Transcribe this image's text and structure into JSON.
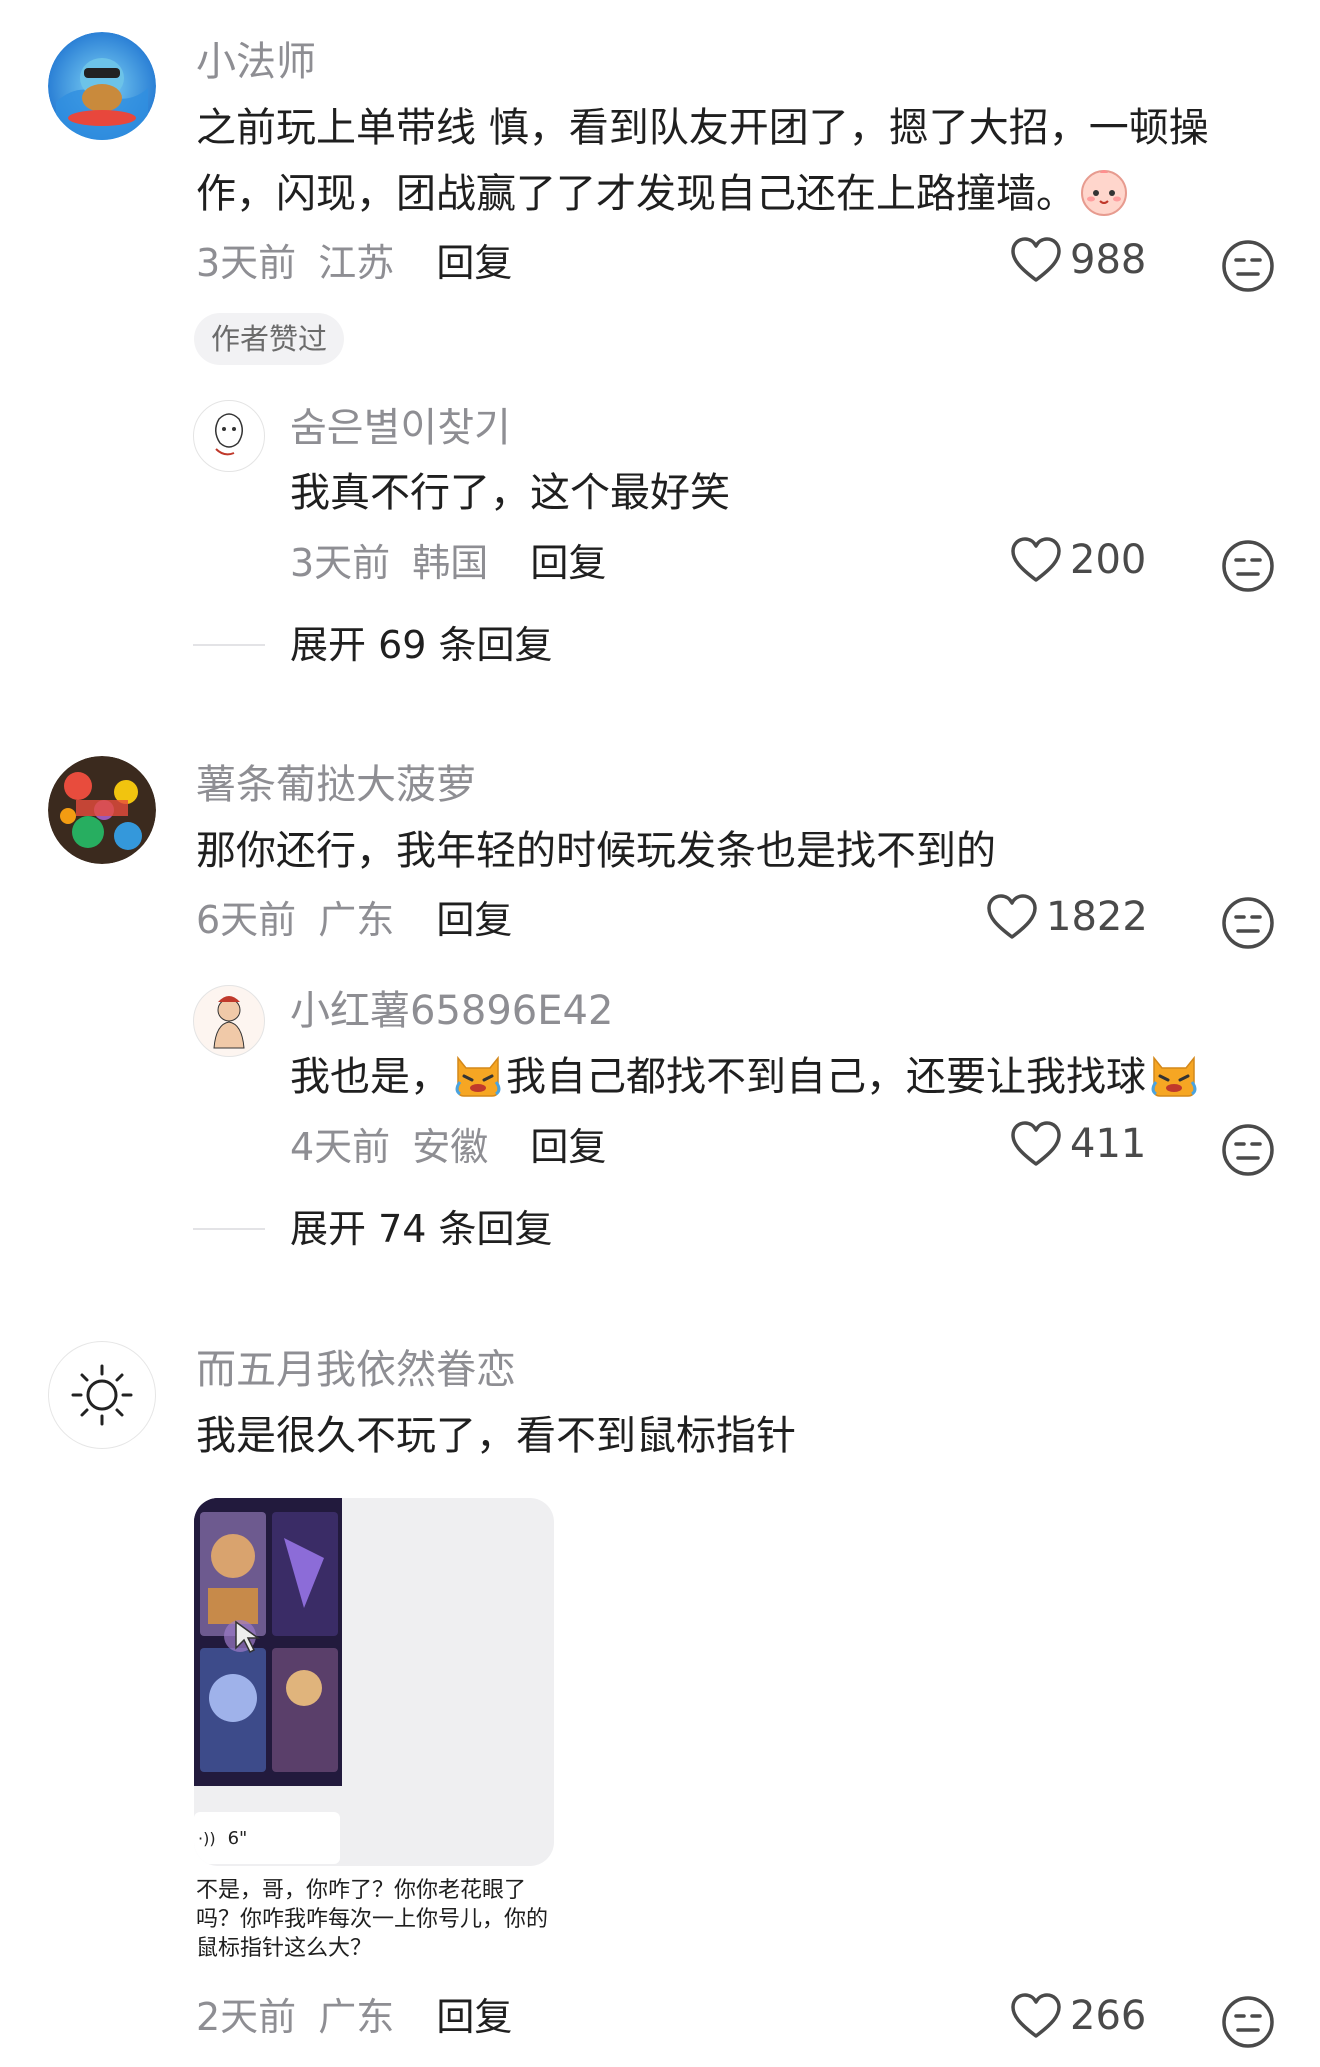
{
  "comments": [
    {
      "username": "小法师",
      "text": "之前玩上单带线 慎，看到队友开团了，摁了大招，一顿操作，闪现，团战赢了了才发现自己还在上路撞墙。",
      "trailing_emoji": "baby-face-emoji",
      "time": "3天前",
      "location": "江苏",
      "reply_label": "回复",
      "likes": "988",
      "badge": "作者赞过",
      "reply": {
        "username": "숨은별이찾기",
        "text": "我真不行了，这个最好笑",
        "time": "3天前",
        "location": "韩国",
        "reply_label": "回复",
        "likes": "200"
      },
      "expand_label": "展开 69 条回复"
    },
    {
      "username": "薯条葡挞大菠萝",
      "text": "那你还行，我年轻的时候玩发条也是找不到的",
      "time": "6天前",
      "location": "广东",
      "reply_label": "回复",
      "likes": "1822",
      "reply": {
        "username": "小红薯65896E42",
        "text_part1": "我也是，",
        "text_part2": "我自己都找不到自己，还要让我找球",
        "emoji": "crying-cat-emoji",
        "time": "4天前",
        "location": "安徽",
        "reply_label": "回复",
        "likes": "411"
      },
      "expand_label": "展开 74 条回复"
    },
    {
      "username": "而五月我依然眷恋",
      "text": "我是很久不玩了，看不到鼠标指针",
      "attachment": {
        "voice_duration": "6\"",
        "caption": "不是，哥，你咋了？你你老花眼了吗？你咋我咋每次一上你号儿，你的鼠标指针这么大？"
      },
      "time": "2天前",
      "location": "广东",
      "reply_label": "回复",
      "likes": "266"
    }
  ],
  "colors": {
    "secondary_text": "#8e8e93",
    "primary_text": "#1f1f1f",
    "badge_bg": "#f2f2f4"
  }
}
